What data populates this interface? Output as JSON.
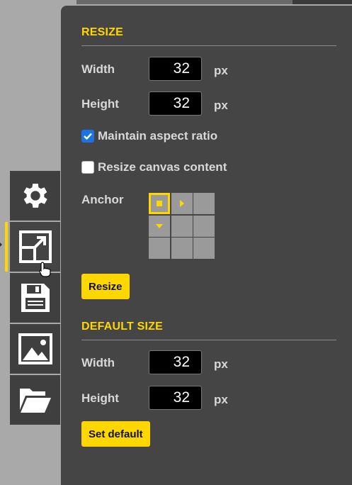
{
  "resize": {
    "title": "RESIZE",
    "width_label": "Width",
    "width_value": "32",
    "height_label": "Height",
    "height_value": "32",
    "unit": "px",
    "maintain_aspect_label": "Maintain aspect ratio",
    "maintain_aspect_checked": true,
    "resize_content_label": "Resize canvas content",
    "resize_content_checked": false,
    "anchor_label": "Anchor",
    "anchor_selected": "top-left",
    "button_label": "Resize"
  },
  "default_size": {
    "title": "DEFAULT SIZE",
    "width_label": "Width",
    "width_value": "32",
    "height_label": "Height",
    "height_value": "32",
    "unit": "px",
    "button_label": "Set default"
  },
  "toolbar": {
    "items": [
      {
        "icon": "gear-icon"
      },
      {
        "icon": "resize-icon",
        "active": true
      },
      {
        "icon": "save-icon"
      },
      {
        "icon": "image-icon"
      },
      {
        "icon": "folder-open-icon"
      }
    ]
  },
  "colors": {
    "accent": "#ffd700",
    "panel": "#454545",
    "toolbar": "#3f3f3f"
  }
}
